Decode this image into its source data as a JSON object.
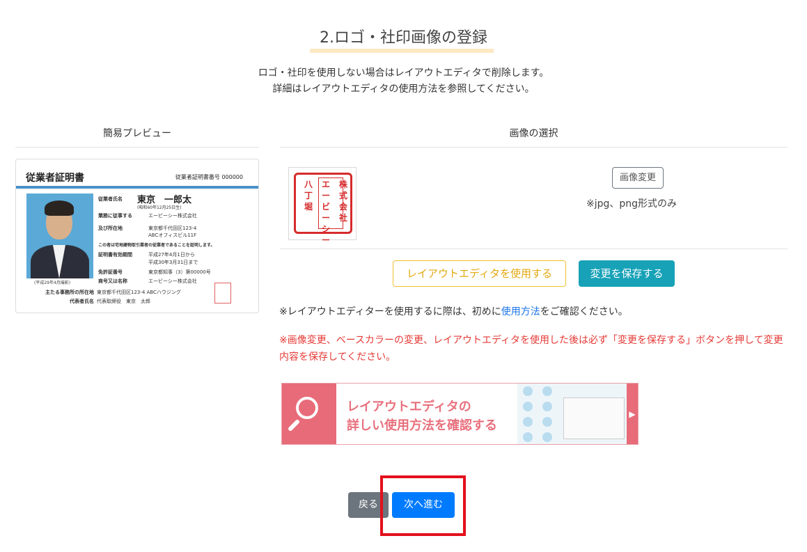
{
  "page": {
    "title": "2.ロゴ・社印画像の登録",
    "subtitle_line1": "ロゴ・社印を使用しない場合はレイアウトエディタで削除します。",
    "subtitle_line2": "詳細はレイアウトエディタの使用方法を参照してください。"
  },
  "preview": {
    "heading": "簡易プレビュー",
    "card": {
      "title": "従業者証明書",
      "number_label": "従業者証明書番号 000000",
      "name": "東京　一郎太",
      "birth": "(昭和60年12月25日生)",
      "rows": [
        {
          "label": "従業者氏名",
          "value": ""
        },
        {
          "label": "業務に従事する",
          "value": "エービーシー株式会社"
        },
        {
          "label": "及び所在地",
          "value": "東京都千代田区123-4"
        },
        {
          "label": "",
          "value": "ABCオフィスビル11F"
        },
        {
          "label": "",
          "value": "この者は宅地建物取引業者の従業者であることを証明します。"
        },
        {
          "label": "証明書有効期間",
          "value": "平成27年4月1日から"
        },
        {
          "label": "",
          "value": "平成30年3月31日まで"
        },
        {
          "label": "免許証番号",
          "value": "東京都知事（3）第00000号"
        },
        {
          "label": "商号又は名称",
          "value": "エービーシー株式会社"
        },
        {
          "label": "主たる事務所の所在地",
          "value": "東京都千代田区123-4 ABCハウジング"
        },
        {
          "label": "代表者氏名",
          "value": "代表取締役　東京　太郎"
        }
      ],
      "photo_caption": "(平成29年4月撮影)"
    }
  },
  "image_select": {
    "heading": "画像の選択",
    "seal_columns": [
      "株式会社",
      "エービーシー",
      "八丁堀"
    ],
    "change_button": "画像変更",
    "format_note": "※jpg、png形式のみ"
  },
  "actions": {
    "editor_button": "レイアウトエディタを使用する",
    "save_button": "変更を保存する"
  },
  "notes": {
    "note1_prefix": "※レイアウトエディターを使用するに際は、初めに",
    "note1_link": "使用方法",
    "note1_suffix": "をご確認ください。",
    "note2": "※画像変更、ベースカラーの変更、レイアウトエディタを使用した後は必ず「変更を保存する」ボタンを押して変更内容を保存してください。"
  },
  "banner": {
    "line1": "レイアウトエディタの",
    "line2": "詳しい使用方法を確認する"
  },
  "footer": {
    "back_button": "戻る",
    "next_button": "次へ進む"
  },
  "colors": {
    "accent_underline": "#fde9c4",
    "save_button": "#17a2b8",
    "editor_button_border": "#f0c030",
    "next_button": "#007bff",
    "back_button": "#6c757d",
    "warning_text": "#e53935",
    "highlight_box": "#e3101c",
    "banner_pink": "#e86b79"
  }
}
